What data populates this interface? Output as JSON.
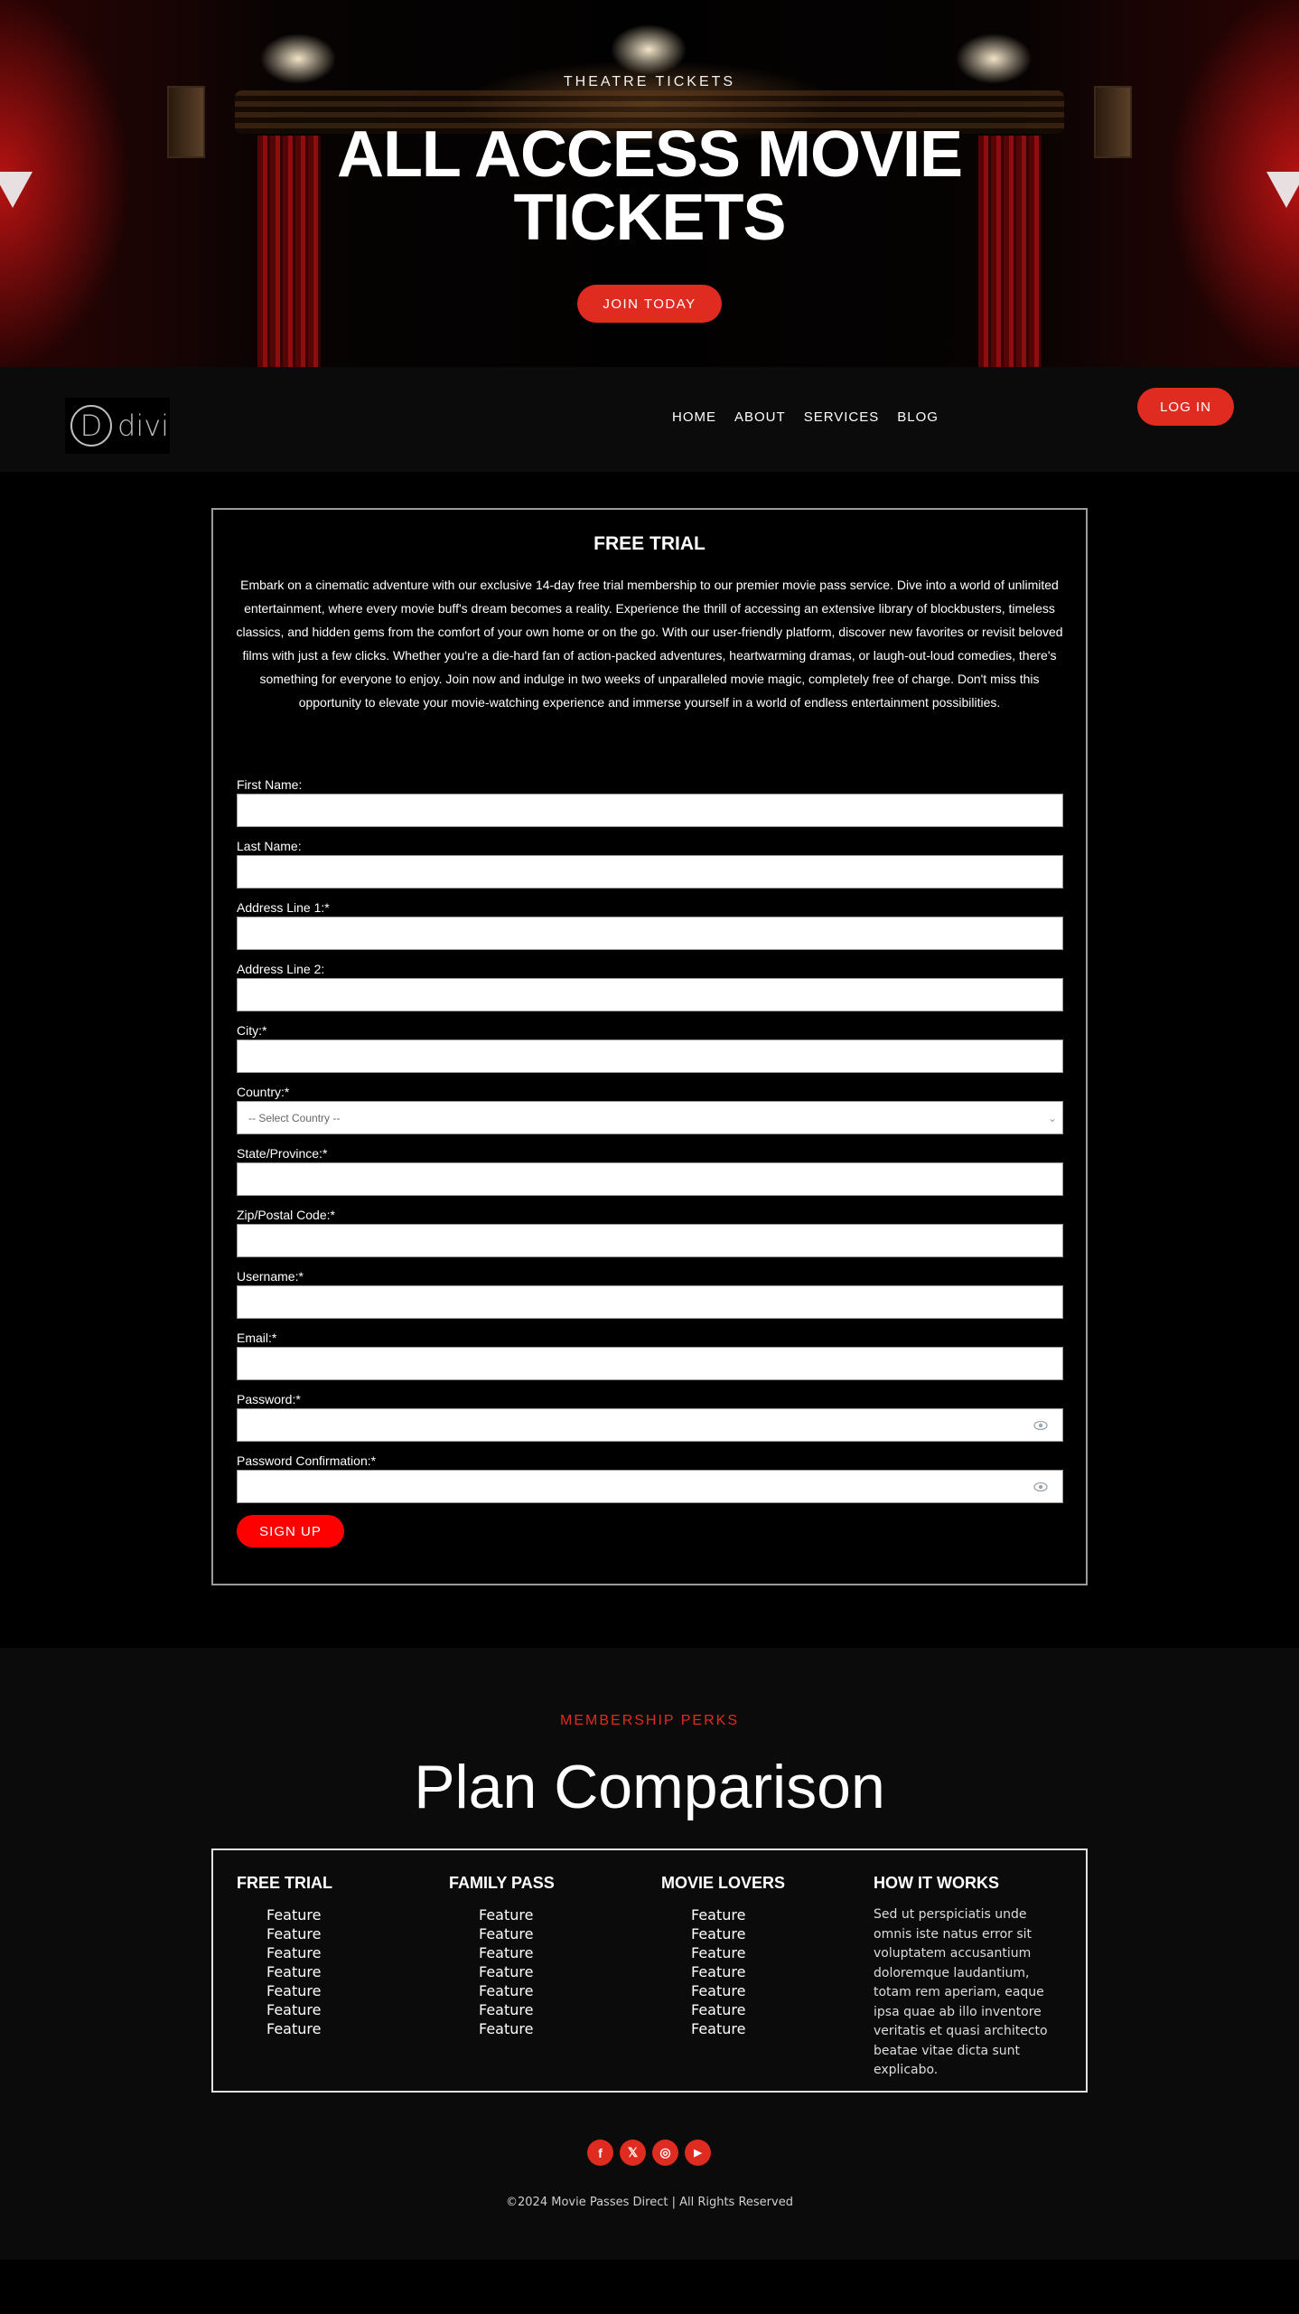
{
  "hero": {
    "eyebrow": "THEATRE TICKETS",
    "title_line1": "ALL ACCESS MOVIE",
    "title_line2": "TICKETS",
    "cta_label": "JOIN TODAY"
  },
  "nav": {
    "logo_letter": "D",
    "logo_text": "divi",
    "items": [
      {
        "label": "HOME"
      },
      {
        "label": "ABOUT"
      },
      {
        "label": "SERVICES"
      },
      {
        "label": "BLOG"
      }
    ],
    "login_label": "LOG IN"
  },
  "trial": {
    "title": "FREE TRIAL",
    "description": "Embark on a cinematic adventure with our exclusive 14-day free trial membership to our premier movie pass service. Dive into a world of unlimited entertainment, where every movie buff's dream becomes a reality. Experience the thrill of accessing an extensive library of blockbusters, timeless classics, and hidden gems from the comfort of your own home or on the go. With our user-friendly platform, discover new favorites or revisit beloved films with just a few clicks. Whether you're a die-hard fan of action-packed adventures, heartwarming dramas, or laugh-out-loud comedies, there's something for everyone to enjoy. Join now and indulge in two weeks of unparalleled movie magic, completely free of charge. Don't miss this opportunity to elevate your movie-watching experience and immerse yourself in a world of endless entertainment possibilities.",
    "fields": {
      "first_name": {
        "label": "First Name:",
        "value": ""
      },
      "last_name": {
        "label": "Last Name:",
        "value": ""
      },
      "address1": {
        "label": "Address Line 1:*",
        "value": ""
      },
      "address2": {
        "label": "Address Line 2:",
        "value": ""
      },
      "city": {
        "label": "City:*",
        "value": ""
      },
      "country": {
        "label": "Country:*",
        "selected": "-- Select Country --"
      },
      "state": {
        "label": "State/Province:*",
        "value": ""
      },
      "zip": {
        "label": "Zip/Postal Code:*",
        "value": ""
      },
      "username": {
        "label": "Username:*",
        "value": ""
      },
      "email": {
        "label": "Email:*",
        "value": ""
      },
      "password": {
        "label": "Password:*",
        "value": ""
      },
      "password_confirm": {
        "label": "Password Confirmation:*",
        "value": ""
      }
    },
    "signup_label": "SIGN UP"
  },
  "plans": {
    "eyebrow": "MEMBERSHIP PERKS",
    "title": "Plan Comparison",
    "columns": [
      {
        "title": "FREE TRIAL",
        "features": [
          "Feature",
          "Feature",
          "Feature",
          "Feature",
          "Feature",
          "Feature",
          "Feature"
        ]
      },
      {
        "title": "FAMILY PASS",
        "features": [
          "Feature",
          "Feature",
          "Feature",
          "Feature",
          "Feature",
          "Feature",
          "Feature"
        ]
      },
      {
        "title": "MOVIE LOVERS",
        "features": [
          "Feature",
          "Feature",
          "Feature",
          "Feature",
          "Feature",
          "Feature",
          "Feature"
        ]
      }
    ],
    "how_it_works": {
      "title": "HOW IT WORKS",
      "text": "Sed ut perspiciatis unde omnis iste natus error sit voluptatem accusantium doloremque laudantium, totam rem aperiam, eaque ipsa quae ab illo inventore veritatis et quasi architecto beatae vitae dicta sunt explicabo."
    }
  },
  "footer": {
    "socials": [
      {
        "name": "facebook",
        "glyph": "f"
      },
      {
        "name": "x-twitter",
        "glyph": "𝕏"
      },
      {
        "name": "instagram",
        "glyph": "◎"
      },
      {
        "name": "youtube",
        "glyph": "▶"
      }
    ],
    "copyright": "©2024 Movie Passes Direct | All Rights Reserved"
  },
  "colors": {
    "accent": "#e02b20",
    "signup": "#ff0000",
    "section_bg": "#0b0b0b"
  }
}
